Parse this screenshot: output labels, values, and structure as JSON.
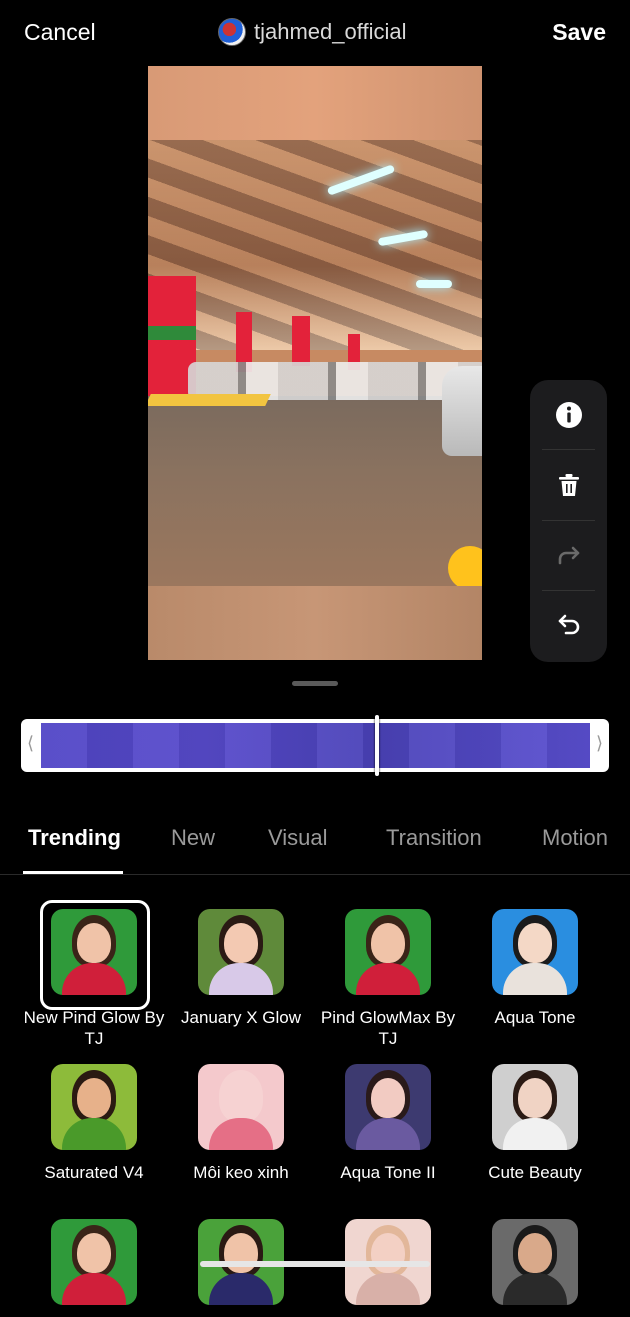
{
  "header": {
    "cancel_label": "Cancel",
    "username": "tjahmed_official",
    "save_label": "Save"
  },
  "side_tools": [
    {
      "name": "info-icon",
      "enabled": true
    },
    {
      "name": "trash-icon",
      "enabled": true
    },
    {
      "name": "redo-icon",
      "enabled": false
    },
    {
      "name": "undo-icon",
      "enabled": true
    }
  ],
  "timeline": {
    "left_chevron": "⟨",
    "right_chevron": "⟩",
    "playhead_fraction": 0.61
  },
  "tabs": [
    {
      "label": "Trending",
      "active": true
    },
    {
      "label": "New",
      "active": false
    },
    {
      "label": "Visual",
      "active": false
    },
    {
      "label": "Transition",
      "active": false
    },
    {
      "label": "Motion",
      "active": false
    }
  ],
  "effects": [
    {
      "label": "New Pind Glow By TJ",
      "selected": true,
      "bg": "#2f9a3a",
      "skin": "#f0c3a8",
      "cloth": "#d01f3a",
      "hair": "#3a2418"
    },
    {
      "label": "January X Glow",
      "selected": false,
      "bg": "#5f8a3a",
      "skin": "#f3c9b2",
      "cloth": "#d8c9e8",
      "hair": "#2a1a14"
    },
    {
      "label": "Pind GlowMax By TJ",
      "selected": false,
      "bg": "#2f9a3a",
      "skin": "#f0c3a8",
      "cloth": "#d01f3a",
      "hair": "#3a2418"
    },
    {
      "label": "Aqua Tone",
      "selected": false,
      "bg": "#2a8ee0",
      "skin": "#f4d8c6",
      "cloth": "#e9e2dc",
      "hair": "#1b1b1b"
    },
    {
      "label": "Saturated V4",
      "selected": false,
      "bg": "#8dbb3a",
      "skin": "#e7b18a",
      "cloth": "#4a9a2a",
      "hair": "#2a1a12"
    },
    {
      "label": "Môi keo xinh",
      "selected": false,
      "bg": "#f4c9cc",
      "skin": "#f6d2d2",
      "cloth": "#e56f86",
      "hair": "#f6d2d2"
    },
    {
      "label": "Aqua Tone II",
      "selected": false,
      "bg": "#3d3a70",
      "skin": "#f2cbc2",
      "cloth": "#6a5aa0",
      "hair": "#2a1a1a"
    },
    {
      "label": "Cute Beauty",
      "selected": false,
      "bg": "#cfcfcf",
      "skin": "#f0d3c4",
      "cloth": "#f1f1f1",
      "hair": "#2a1a14"
    },
    {
      "label": "",
      "selected": false,
      "bg": "#2f9a3a",
      "skin": "#f0c3a8",
      "cloth": "#d01f3a",
      "hair": "#3a2418"
    },
    {
      "label": "",
      "selected": false,
      "bg": "#4aa23a",
      "skin": "#f0c3a8",
      "cloth": "#2a2a6a",
      "hair": "#2a1a14"
    },
    {
      "label": "",
      "selected": false,
      "bg": "#f0d6d0",
      "skin": "#f3d0c4",
      "cloth": "#d8b0a8",
      "hair": "#e2b79a"
    },
    {
      "label": "",
      "selected": false,
      "bg": "#6a6a6a",
      "skin": "#d9a98a",
      "cloth": "#2a2a2a",
      "hair": "#1a1a1a"
    }
  ]
}
